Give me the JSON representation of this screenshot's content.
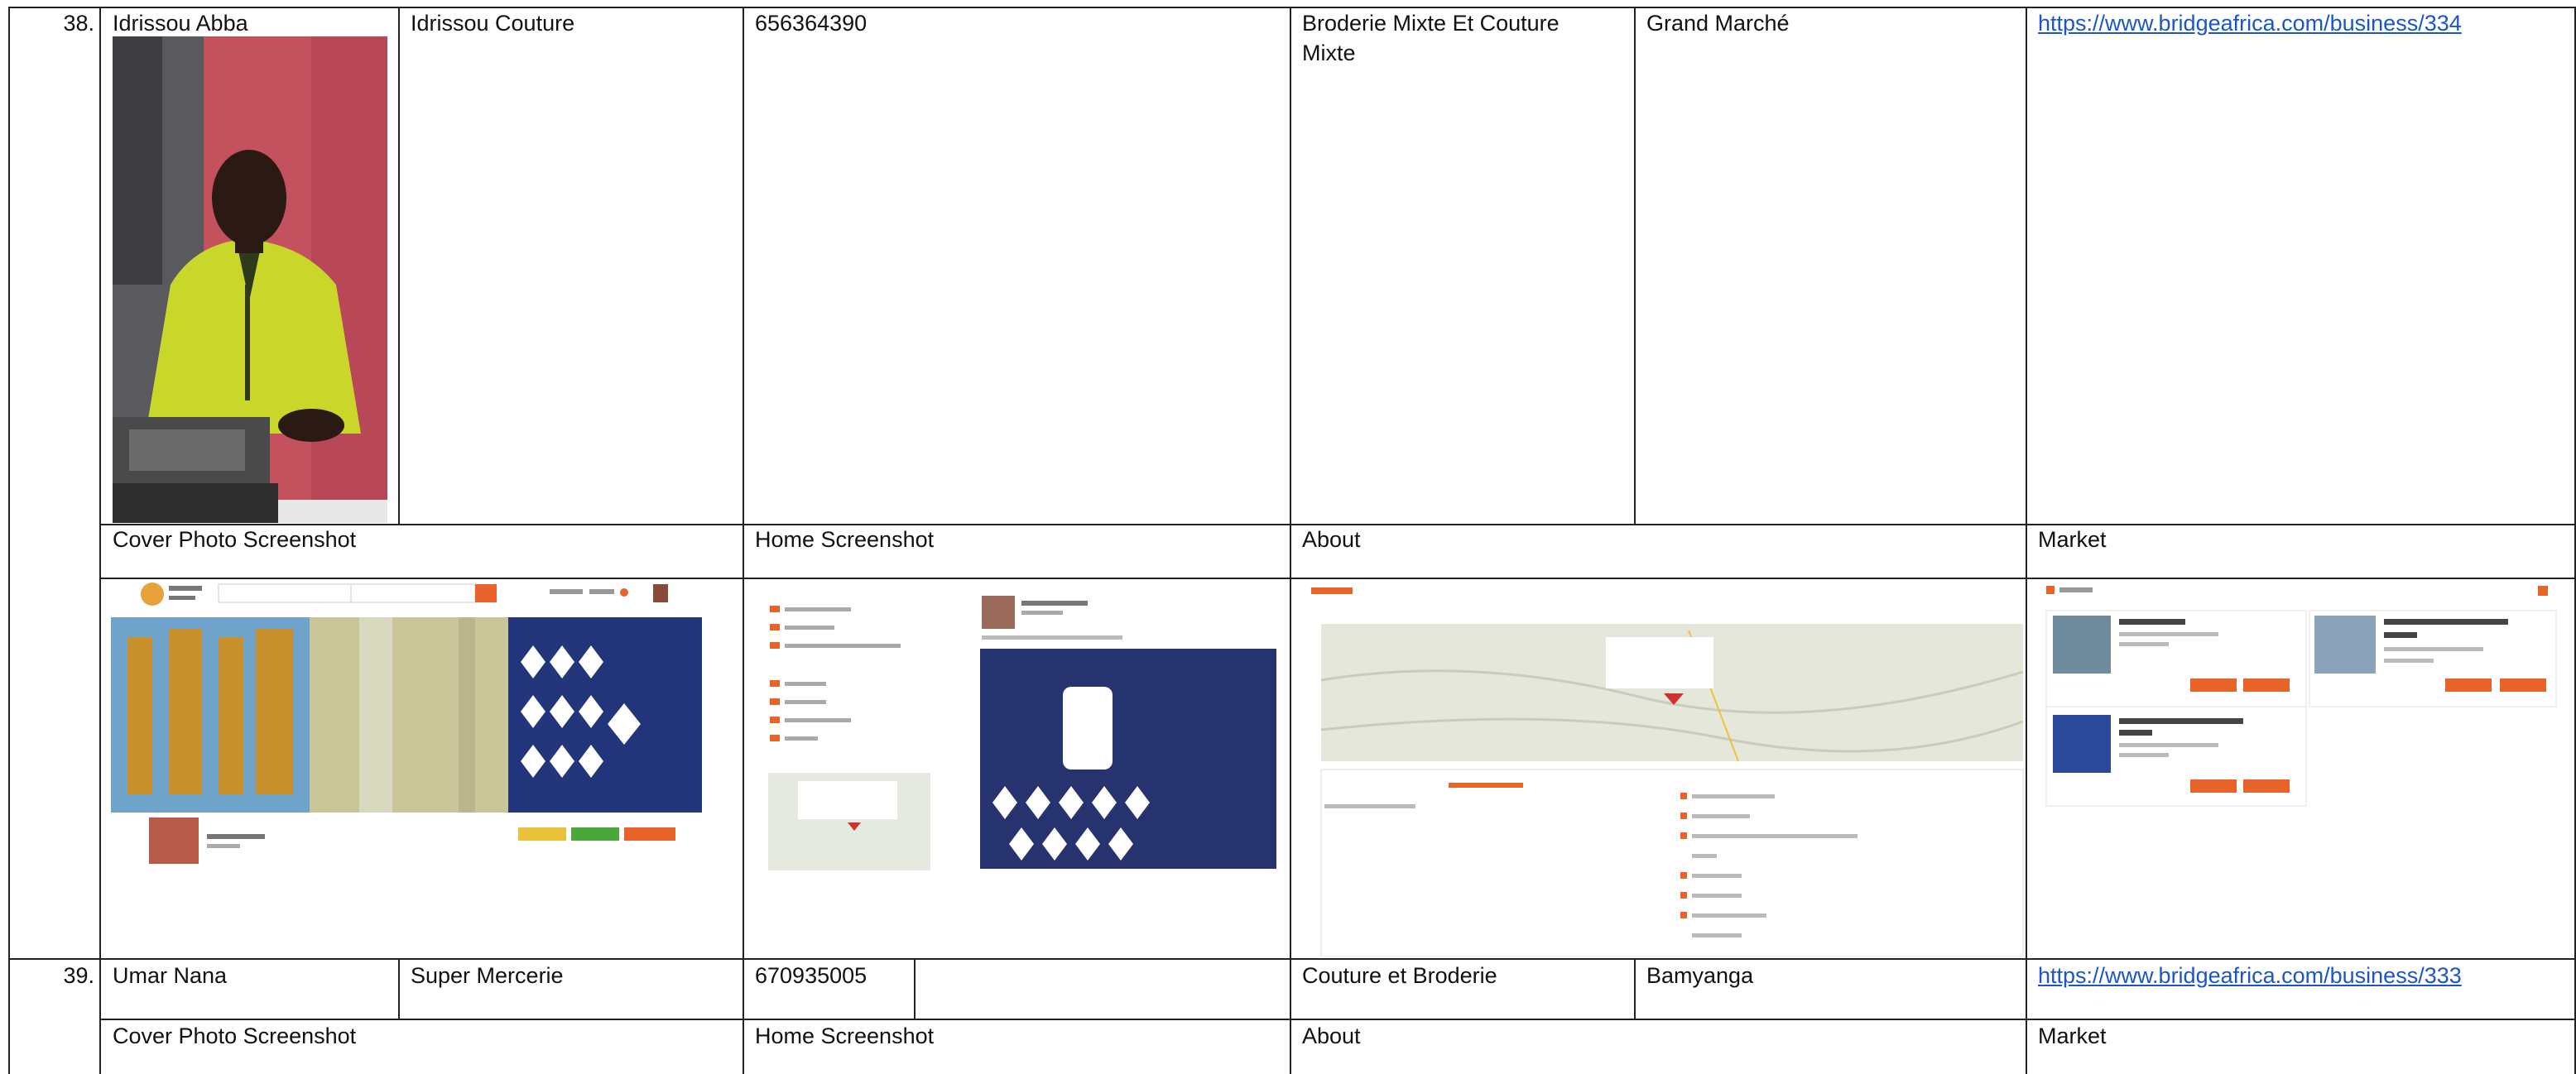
{
  "rows": [
    {
      "number": "38.",
      "owner": "Idrissou Abba",
      "business": "Idrissou Couture",
      "phone": "656364390",
      "category": "Broderie Mixte Et Couture Mixte",
      "location": "Grand Marché",
      "url": "https://www.bridgeafrica.com/business/334",
      "labels": {
        "cover": "Cover Photo Screenshot",
        "home": "Home Screenshot",
        "about": "About",
        "market": "Market"
      }
    },
    {
      "number": "39.",
      "owner": "Umar Nana",
      "business": "Super Mercerie",
      "phone": "670935005",
      "category": "Couture et Broderie",
      "location": "Bamyanga",
      "url": "https://www.bridgeafrica.com/business/333",
      "labels": {
        "cover": "Cover Photo Screenshot",
        "home": "Home Screenshot",
        "about": "About",
        "market": "Market"
      }
    }
  ],
  "colors": {
    "link": "#1a56c9",
    "brand_orange": "#e8632a",
    "grid": "#222222"
  }
}
